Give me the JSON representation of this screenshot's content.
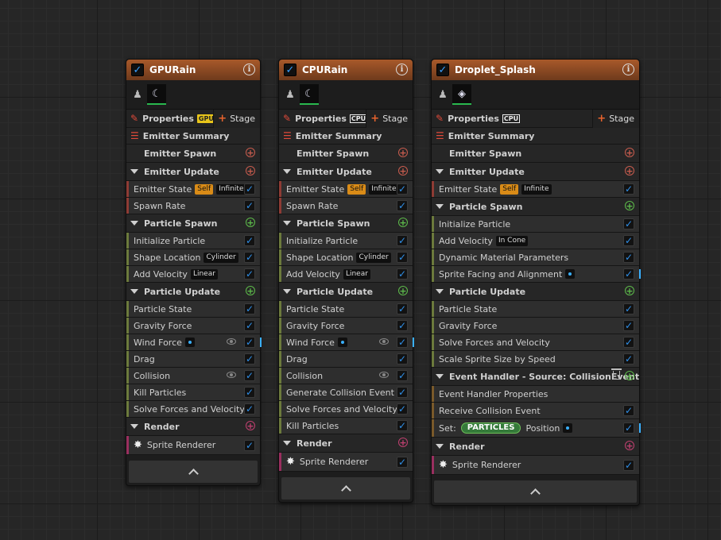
{
  "emitters": [
    {
      "title": "GPURain",
      "sim_badge": "GPU",
      "props_label": "Properties",
      "stage_label": "Stage",
      "summary_label": "Emitter Summary",
      "emitter_spawn": "Emitter Spawn",
      "emitter_update": "Emitter Update",
      "emitter_update_items": [
        {
          "label": "Emitter State",
          "tags": [
            "Self",
            "Infinite"
          ]
        },
        {
          "label": "Spawn Rate",
          "tags": []
        }
      ],
      "particle_spawn": "Particle Spawn",
      "particle_spawn_items": [
        {
          "label": "Initialize Particle",
          "tags": []
        },
        {
          "label": "Shape Location",
          "tags": [
            "Cylinder"
          ]
        },
        {
          "label": "Add Velocity",
          "tags": [
            "Linear"
          ]
        }
      ],
      "particle_update": "Particle Update",
      "particle_update_items": [
        {
          "label": "Particle State"
        },
        {
          "label": "Gravity Force"
        },
        {
          "label": "Wind Force",
          "dot": true,
          "eye": true,
          "bar": true
        },
        {
          "label": "Drag"
        },
        {
          "label": "Collision",
          "eye": true
        },
        {
          "label": "Kill Particles"
        },
        {
          "label": "Solve Forces and Velocity"
        }
      ],
      "render": "Render",
      "renderer": "Sprite Renderer"
    },
    {
      "title": "CPURain",
      "sim_badge": "CPU",
      "props_label": "Properties",
      "stage_label": "Stage",
      "summary_label": "Emitter Summary",
      "emitter_spawn": "Emitter Spawn",
      "emitter_update": "Emitter Update",
      "emitter_update_items": [
        {
          "label": "Emitter State",
          "tags": [
            "Self",
            "Infinite"
          ]
        },
        {
          "label": "Spawn Rate",
          "tags": []
        }
      ],
      "particle_spawn": "Particle Spawn",
      "particle_spawn_items": [
        {
          "label": "Initialize Particle",
          "tags": []
        },
        {
          "label": "Shape Location",
          "tags": [
            "Cylinder"
          ]
        },
        {
          "label": "Add Velocity",
          "tags": [
            "Linear"
          ]
        }
      ],
      "particle_update": "Particle Update",
      "particle_update_items": [
        {
          "label": "Particle State"
        },
        {
          "label": "Gravity Force"
        },
        {
          "label": "Wind Force",
          "dot": true,
          "eye": true,
          "bar": true
        },
        {
          "label": "Drag"
        },
        {
          "label": "Collision",
          "eye": true
        },
        {
          "label": "Generate Collision Event"
        },
        {
          "label": "Solve Forces and Velocity"
        },
        {
          "label": "Kill Particles"
        }
      ],
      "render": "Render",
      "renderer": "Sprite Renderer"
    },
    {
      "title": "Droplet_Splash",
      "sim_badge": "CPU",
      "props_label": "Properties",
      "stage_label": "Stage",
      "summary_label": "Emitter Summary",
      "emitter_spawn": "Emitter Spawn",
      "emitter_update": "Emitter Update",
      "emitter_update_items": [
        {
          "label": "Emitter State",
          "tags": [
            "Self",
            "Infinite"
          ]
        }
      ],
      "particle_spawn": "Particle Spawn",
      "particle_spawn_items": [
        {
          "label": "Initialize Particle",
          "tags": []
        },
        {
          "label": "Add Velocity",
          "tags": [
            "In Cone"
          ]
        },
        {
          "label": "Dynamic Material Parameters",
          "tags": []
        },
        {
          "label": "Sprite Facing and Alignment",
          "tags": [],
          "dot": true,
          "bar": true
        }
      ],
      "particle_update": "Particle Update",
      "particle_update_items": [
        {
          "label": "Particle State"
        },
        {
          "label": "Gravity Force"
        },
        {
          "label": "Solve Forces and Velocity"
        },
        {
          "label": "Scale Sprite Size by Speed"
        }
      ],
      "event_handler": "Event Handler - Source: CollisionEvent",
      "event_items": {
        "props": "Event Handler Properties",
        "receive": "Receive Collision Event",
        "set_label": "Set:",
        "set_pill": "PARTICLES",
        "set_value": "Position"
      },
      "render": "Render",
      "renderer": "Sprite Renderer"
    }
  ]
}
